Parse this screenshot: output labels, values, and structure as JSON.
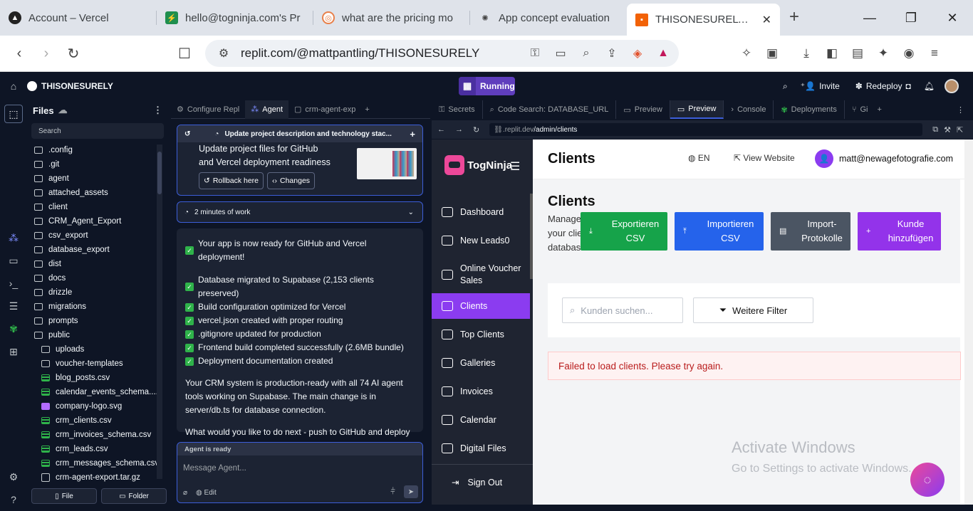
{
  "browser": {
    "tabs": [
      {
        "title": "Account – Vercel",
        "icon": "vercel-icon",
        "color": "#000000"
      },
      {
        "title": "hello@togninja.com's Pr",
        "icon": "supabase-icon",
        "color": "#3ecf8e"
      },
      {
        "title": "what are the pricing mo",
        "icon": "perplexity-icon",
        "color": "#e8804a"
      },
      {
        "title": "App concept evaluation",
        "icon": "chatgpt-icon",
        "color": "#444444"
      },
      {
        "title": "THISONESURELY - R",
        "icon": "replit-icon",
        "color": "#f26207"
      }
    ],
    "url": "replit.com/@mattpantling/THISONESURELY"
  },
  "replit": {
    "project": "THISONESURELY",
    "run_status": "Running",
    "invite": "Invite",
    "redeploy": "Redeploy",
    "files_title": "Files",
    "search_placeholder": "Search",
    "file_button": "File",
    "folder_button": "Folder",
    "files": [
      {
        "name": ".config",
        "type": "folder",
        "indent": 0
      },
      {
        "name": ".git",
        "type": "folder",
        "indent": 0
      },
      {
        "name": "agent",
        "type": "folder",
        "indent": 0
      },
      {
        "name": "attached_assets",
        "type": "folder",
        "indent": 0
      },
      {
        "name": "client",
        "type": "folder",
        "indent": 0
      },
      {
        "name": "CRM_Agent_Export",
        "type": "folder",
        "indent": 0
      },
      {
        "name": "csv_export",
        "type": "folder",
        "indent": 0
      },
      {
        "name": "database_export",
        "type": "folder",
        "indent": 0
      },
      {
        "name": "dist",
        "type": "folder",
        "indent": 0
      },
      {
        "name": "docs",
        "type": "folder",
        "indent": 0
      },
      {
        "name": "drizzle",
        "type": "folder",
        "indent": 0
      },
      {
        "name": "migrations",
        "type": "folder",
        "indent": 0
      },
      {
        "name": "prompts",
        "type": "folder",
        "indent": 0
      },
      {
        "name": "public",
        "type": "folder",
        "indent": 0
      },
      {
        "name": "uploads",
        "type": "folder",
        "indent": 1
      },
      {
        "name": "voucher-templates",
        "type": "folder",
        "indent": 1
      },
      {
        "name": "blog_posts.csv",
        "type": "file",
        "indent": 1
      },
      {
        "name": "calendar_events_schema....",
        "type": "file",
        "indent": 1
      },
      {
        "name": "company-logo.svg",
        "type": "svg",
        "indent": 1
      },
      {
        "name": "crm_clients.csv",
        "type": "file",
        "indent": 1
      },
      {
        "name": "crm_invoices_schema.csv",
        "type": "file",
        "indent": 1
      },
      {
        "name": "crm_leads.csv",
        "type": "file",
        "indent": 1
      },
      {
        "name": "crm_messages_schema.csv",
        "type": "file",
        "indent": 1
      },
      {
        "name": "crm-agent-export.tar.gz",
        "type": "doc",
        "indent": 1
      }
    ],
    "agent_tabs": [
      "Configure Repl",
      "Agent",
      "crm-agent-exp"
    ],
    "checkpoint_header": "Update project description and technology stac...",
    "checkpoint_title": "Update project files for GitHub and Vercel deployment readiness",
    "rollback": "Rollback here",
    "changes": "Changes",
    "work_time": "2 minutes of work",
    "message": {
      "checks": [
        "Your app is now ready for GitHub and Vercel deployment!",
        "Database migrated to Supabase (2,153 clients preserved)",
        "Build configuration optimized for Vercel",
        "vercel.json created with proper routing",
        ".gitignore updated for production",
        "Frontend build completed successfully (2.6MB bundle)",
        "Deployment documentation created"
      ],
      "p1": "Your CRM system is production-ready with all 74 AI agent tools working on Supabase. The main change is in server/db.ts for database connection.",
      "p2": "What would you like to do next - push to GitHub and deploy to Vercel?"
    },
    "agent_status": "Agent is ready",
    "message_placeholder": "Message Agent...",
    "edit_label": "Edit",
    "right_tabs": [
      "Secrets",
      "Code Search: DATABASE_URL",
      "Preview",
      "Preview",
      "Console",
      "Deployments",
      "Gi"
    ],
    "preview_url_dim": ".replit.dev",
    "preview_url_path": "/admin/clients"
  },
  "webapp": {
    "brand": "TogNinja",
    "nav": [
      "Dashboard",
      "New Leads0",
      "Online Voucher Sales",
      "Clients",
      "Top Clients",
      "Galleries",
      "Invoices",
      "Calendar",
      "Digital Files"
    ],
    "active_nav": "Clients",
    "sign_out": "Sign Out",
    "header_title": "Clients",
    "lang": "EN",
    "view_website": "View Website",
    "user_email": "matt@newagefotografie.com",
    "user_initial": "👤",
    "page_title": "Clients",
    "subtitle": "Manage your client database",
    "actions": [
      {
        "label": "Exportieren CSV",
        "color": "#16a34a",
        "icon": "download-icon"
      },
      {
        "label": "Importieren CSV",
        "color": "#2563eb",
        "icon": "upload-icon"
      },
      {
        "label": "Import-Protokolle",
        "color": "#4b5563",
        "icon": "document-icon"
      },
      {
        "label": "Kunde hinzufügen",
        "color": "#9333ea",
        "icon": "plus-icon"
      }
    ],
    "search_placeholder": "Kunden suchen...",
    "filter_label": "Weitere Filter",
    "error": "Failed to load clients. Please try again."
  },
  "windows_watermark": {
    "line1": "Activate Windows",
    "line2": "Go to Settings to activate Windows."
  }
}
